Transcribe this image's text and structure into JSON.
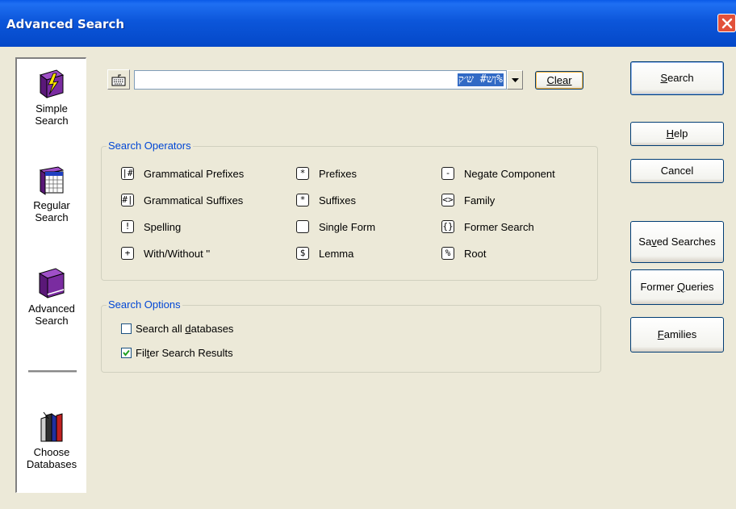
{
  "window": {
    "title": "Advanced Search"
  },
  "sidebar": {
    "items": [
      {
        "line1": "Simple",
        "line2": "Search",
        "icon": "lightning-book-icon"
      },
      {
        "line1": "Regular",
        "line2": "Search",
        "icon": "grid-book-icon"
      },
      {
        "line1": "Advanced",
        "line2": "Search",
        "icon": "purple-book-icon"
      },
      {
        "line1": "Choose",
        "line2": "Databases",
        "icon": "books-icon"
      }
    ]
  },
  "search": {
    "value": "ןש# ש׳ק%",
    "clear_label": "Clear"
  },
  "operators": {
    "title": "Search Operators",
    "items": [
      {
        "sym": "|#",
        "label": "Grammatical Prefixes"
      },
      {
        "sym": "#|",
        "label": "Grammatical Suffixes"
      },
      {
        "sym": "!",
        "label": "Spelling"
      },
      {
        "sym": "+",
        "label": "With/Without ''"
      },
      {
        "sym": "*",
        "label": "Prefixes"
      },
      {
        "sym": "*",
        "label": "Suffixes"
      },
      {
        "sym": "",
        "label": "Single Form"
      },
      {
        "sym": "$",
        "label": "Lemma"
      },
      {
        "sym": "-",
        "label": "Negate Component"
      },
      {
        "sym": "<>",
        "label": "Family"
      },
      {
        "sym": "{}",
        "label": "Former Search"
      },
      {
        "sym": "%",
        "label": "Root"
      }
    ]
  },
  "options": {
    "title": "Search Options",
    "search_all": {
      "pre": "Search all ",
      "ul": "d",
      "post": "atabases",
      "checked": false
    },
    "filter": {
      "pre": "Fil",
      "ul": "t",
      "post": "er Search Results",
      "checked": true
    }
  },
  "buttons": {
    "search": {
      "ul": "S",
      "post": "earch"
    },
    "help": {
      "ul": "H",
      "post": "elp"
    },
    "cancel": {
      "label": "Cancel"
    },
    "saved": {
      "pre": "Sa",
      "ul": "v",
      "post": "ed Searches"
    },
    "former": {
      "pre": "Former ",
      "ul": "Q",
      "post": "ueries"
    },
    "families": {
      "ul": "F",
      "post": "amilies"
    }
  },
  "colors": {
    "titlebar": "#0A5AE8",
    "group_title": "#0046D5",
    "selection": "#316AC5"
  }
}
